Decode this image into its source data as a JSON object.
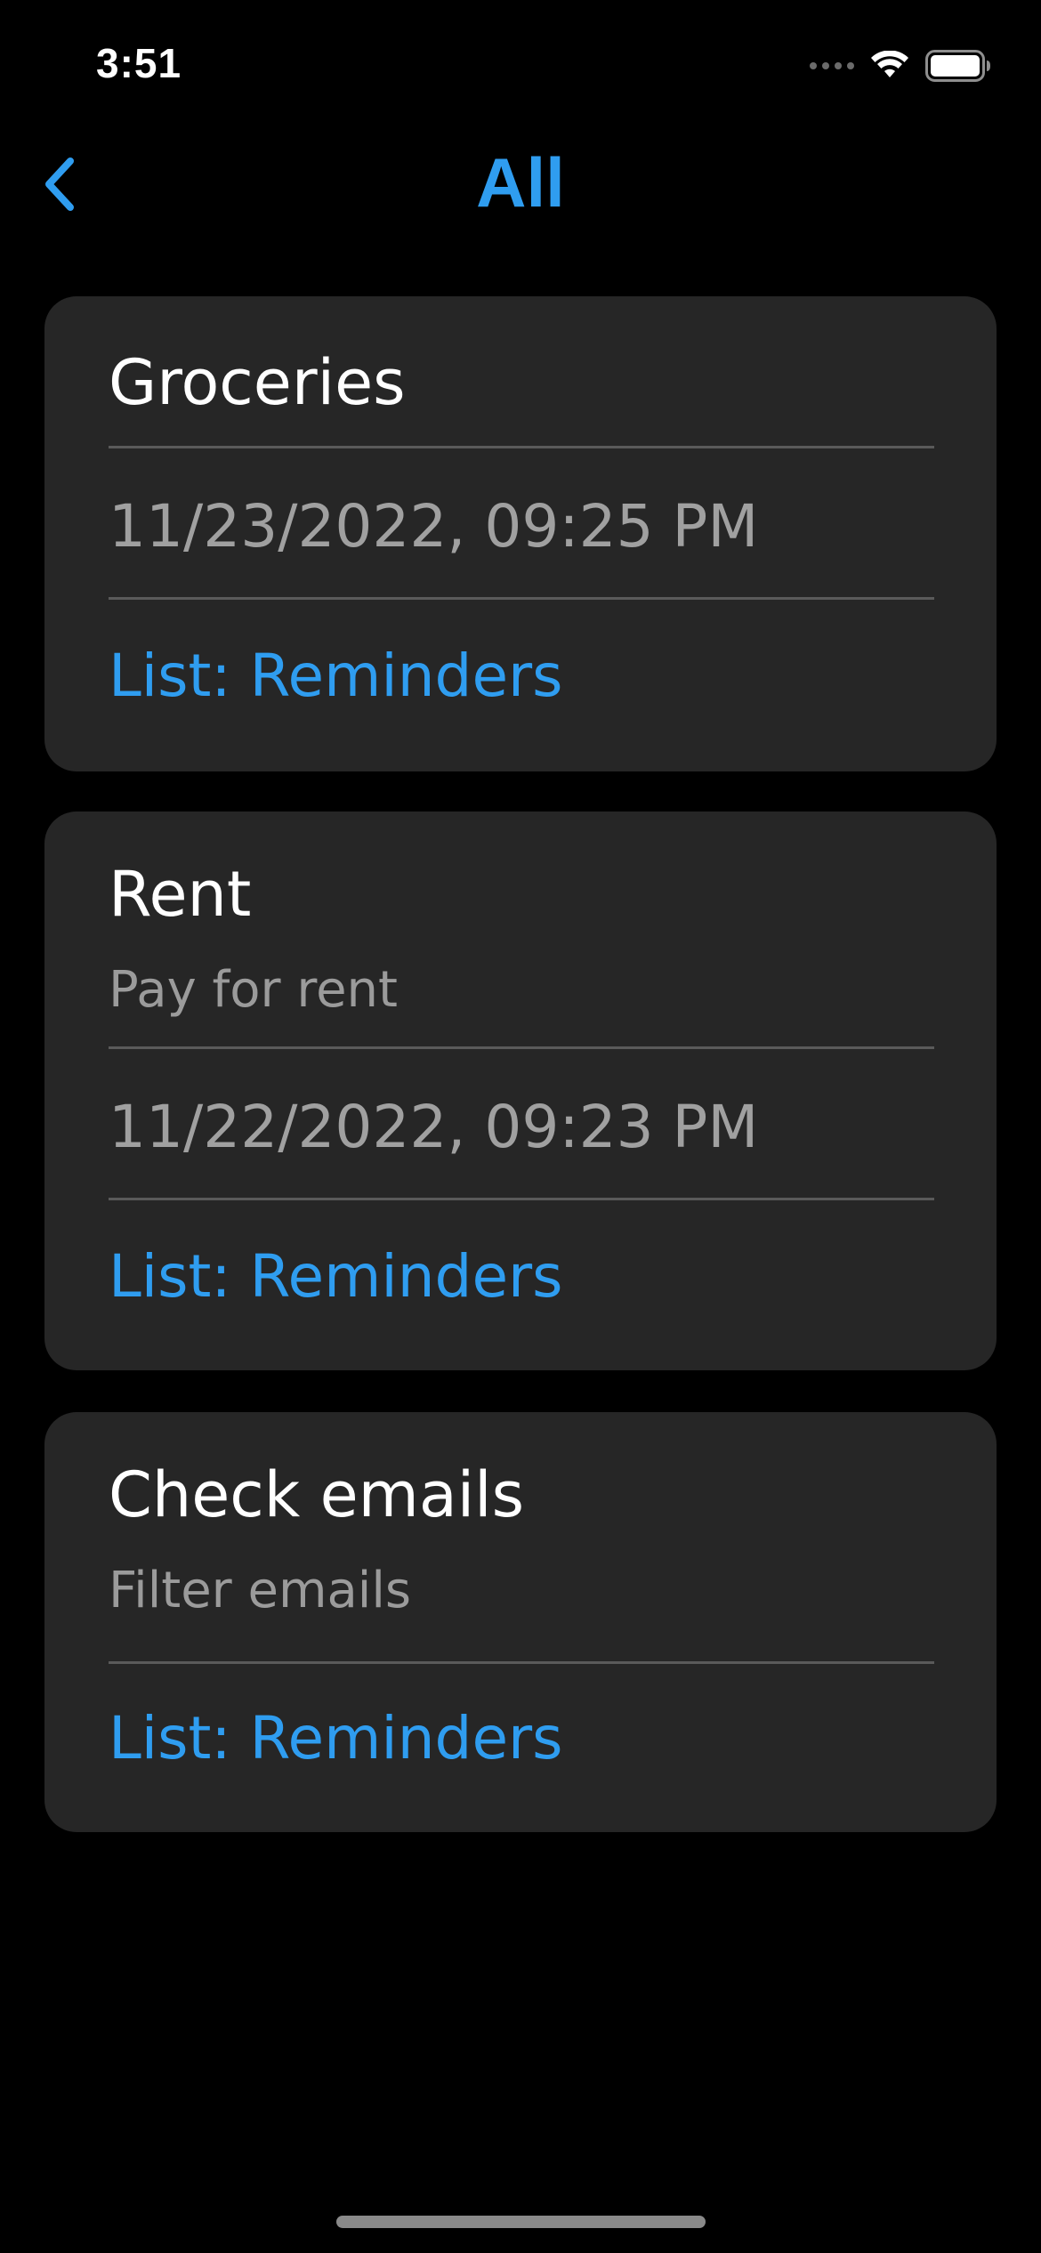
{
  "status_bar": {
    "time": "3:51",
    "icons": [
      "cellular-signal-icon",
      "wifi-icon",
      "battery-icon"
    ]
  },
  "nav": {
    "back_icon": "chevron-left-icon",
    "title": "All"
  },
  "colors": {
    "accent": "#2f9df0",
    "background": "#000000",
    "card": "#262626",
    "secondary_text": "#9b9b9b"
  },
  "reminders": [
    {
      "title": "Groceries",
      "date": "11/23/2022, 09:25 PM",
      "list": "List: Reminders"
    },
    {
      "title": "Rent",
      "notes": "Pay for rent",
      "date": "11/22/2022, 09:23 PM",
      "list": "List: Reminders"
    },
    {
      "title": "Check emails",
      "notes": "Filter emails",
      "list": "List: Reminders"
    }
  ]
}
